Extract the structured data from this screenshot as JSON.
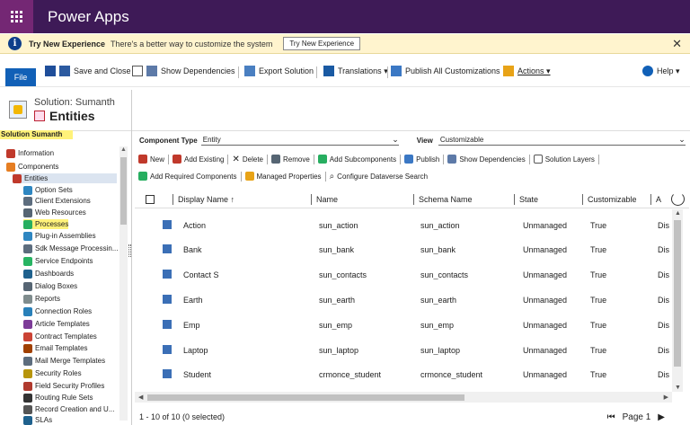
{
  "app": {
    "title": "Power Apps"
  },
  "banner": {
    "title": "Try New Experience",
    "message": "There's a better way to customize the system",
    "button_label": "Try New Experience",
    "close_label": "✕"
  },
  "commandbar": {
    "file": "File",
    "save_close": "Save and Close",
    "show_dependencies": "Show Dependencies",
    "export_solution": "Export Solution",
    "translations": "Translations ▾",
    "publish_all": "Publish All Customizations",
    "actions": "Actions ▾",
    "help": "Help ▾"
  },
  "solution": {
    "name": "Solution: Sumanth",
    "section": "Entities",
    "sidebar_header": "Solution Sumanth"
  },
  "sidebar": {
    "items": [
      {
        "label": "Information",
        "color": "#c0392b"
      },
      {
        "label": "Components",
        "color": "#e67e22"
      },
      {
        "label": "Entities",
        "color": "#c0392b"
      },
      {
        "label": "Option Sets",
        "color": "#2e86c1"
      },
      {
        "label": "Client Extensions",
        "color": "#5d6d7e"
      },
      {
        "label": "Web Resources",
        "color": "#566573"
      },
      {
        "label": "Processes",
        "color": "#27ae60"
      },
      {
        "label": "Plug-in Assemblies",
        "color": "#2e86c1"
      },
      {
        "label": "Sdk Message Processin...",
        "color": "#5d6d7e"
      },
      {
        "label": "Service Endpoints",
        "color": "#28b463"
      },
      {
        "label": "Dashboards",
        "color": "#1f618d"
      },
      {
        "label": "Dialog Boxes",
        "color": "#566573"
      },
      {
        "label": "Reports",
        "color": "#7f8c8d"
      },
      {
        "label": "Connection Roles",
        "color": "#2980b9"
      },
      {
        "label": "Article Templates",
        "color": "#7d3c98"
      },
      {
        "label": "Contract Templates",
        "color": "#cb4335"
      },
      {
        "label": "Email Templates",
        "color": "#a04000"
      },
      {
        "label": "Mail Merge Templates",
        "color": "#5d6d7e"
      },
      {
        "label": "Security Roles",
        "color": "#b7950b"
      },
      {
        "label": "Field Security Profiles",
        "color": "#b03a2e"
      },
      {
        "label": "Routing Rule Sets",
        "color": "#333333"
      },
      {
        "label": "Record Creation and U...",
        "color": "#555555"
      },
      {
        "label": "SLAs",
        "color": "#1f618d"
      }
    ]
  },
  "filters": {
    "component_type_label": "Component Type",
    "component_type_value": "Entity",
    "view_label": "View",
    "view_value": "Customizable"
  },
  "toolbar": {
    "new": "New",
    "add_existing": "Add Existing",
    "delete": "Delete",
    "remove": "Remove",
    "add_subcomponents": "Add Subcomponents",
    "publish": "Publish",
    "show_dependencies": "Show Dependencies",
    "solution_layers": "Solution Layers",
    "add_required": "Add Required Components",
    "managed_properties": "Managed Properties",
    "configure_dataverse": "Configure Dataverse Search"
  },
  "grid": {
    "columns": [
      "Display Name ↑",
      "Name",
      "Schema Name",
      "State",
      "Customizable",
      "A"
    ],
    "rows": [
      [
        "Action",
        "sun_action",
        "sun_action",
        "Unmanaged",
        "True",
        "Dis"
      ],
      [
        "Bank",
        "sun_bank",
        "sun_bank",
        "Unmanaged",
        "True",
        "Dis"
      ],
      [
        "Contact S",
        "sun_contacts",
        "sun_contacts",
        "Unmanaged",
        "True",
        "Dis"
      ],
      [
        "Earth",
        "sun_earth",
        "sun_earth",
        "Unmanaged",
        "True",
        "Dis"
      ],
      [
        "Emp",
        "sun_emp",
        "sun_emp",
        "Unmanaged",
        "True",
        "Dis"
      ],
      [
        "Laptop",
        "sun_laptop",
        "sun_laptop",
        "Unmanaged",
        "True",
        "Dis"
      ],
      [
        "Student",
        "crmonce_student",
        "crmonce_student",
        "Unmanaged",
        "True",
        "Dis"
      ]
    ]
  },
  "footer": {
    "status": "1 - 10 of 10 (0 selected)",
    "page": "Page 1"
  }
}
